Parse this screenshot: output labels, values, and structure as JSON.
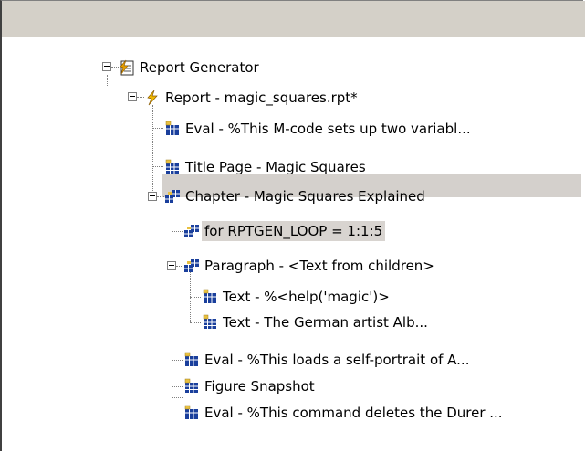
{
  "tree": {
    "nodes": [
      {
        "label": "Report Generator",
        "icon": "report-generator-icon"
      },
      {
        "label": "Report - magic_squares.rpt*",
        "icon": "report-icon"
      },
      {
        "label": "Eval - %This M-code sets up two variabl...",
        "icon": "component-icon"
      },
      {
        "label": "Title Page - Magic Squares",
        "icon": "component-icon"
      },
      {
        "label": "Chapter - Magic Squares Explained",
        "icon": "component-parent-icon"
      },
      {
        "label": "for RPTGEN_LOOP = 1:1:5",
        "icon": "component-parent-icon",
        "selected": true
      },
      {
        "label": "Paragraph - <Text from children>",
        "icon": "component-parent-icon"
      },
      {
        "label": "Text - %<help('magic')>",
        "icon": "component-icon"
      },
      {
        "label": "Text - The German artist Alb...",
        "icon": "component-icon"
      },
      {
        "label": "Eval - %This loads a self-portrait of A...",
        "icon": "component-icon"
      },
      {
        "label": "Figure Snapshot",
        "icon": "component-icon"
      },
      {
        "label": "Eval - %This command deletes the Durer ...",
        "icon": "component-icon"
      }
    ]
  },
  "colors": {
    "header": "#d4d0c8",
    "selection": "#d4d0cc",
    "grid_icon": "#1a3f9c",
    "folder_icon": "#e8c040",
    "lightning": "#e8b000"
  }
}
